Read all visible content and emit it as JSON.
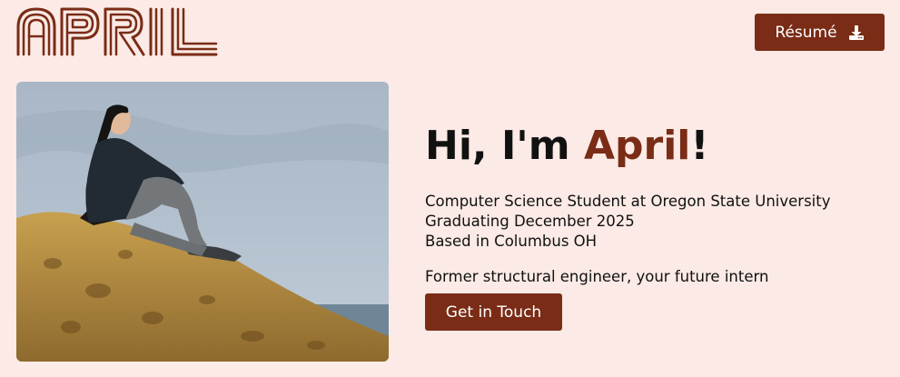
{
  "header": {
    "logo_text": "APRIL",
    "resume_label": "Résumé",
    "resume_icon": "download-icon"
  },
  "hero": {
    "photo_alt": "photo-of-april",
    "greeting_prefix": "Hi, I'm ",
    "name": "April",
    "greeting_suffix": "!",
    "info_lines": [
      "Computer Science Student at Oregon State University",
      "Graduating December 2025",
      "Based in Columbus OH"
    ],
    "tagline": "Former structural engineer, your future intern",
    "cta_label": "Get in Touch"
  },
  "colors": {
    "background": "#fbeae5",
    "accent": "#7a2c16",
    "text": "#111111"
  }
}
